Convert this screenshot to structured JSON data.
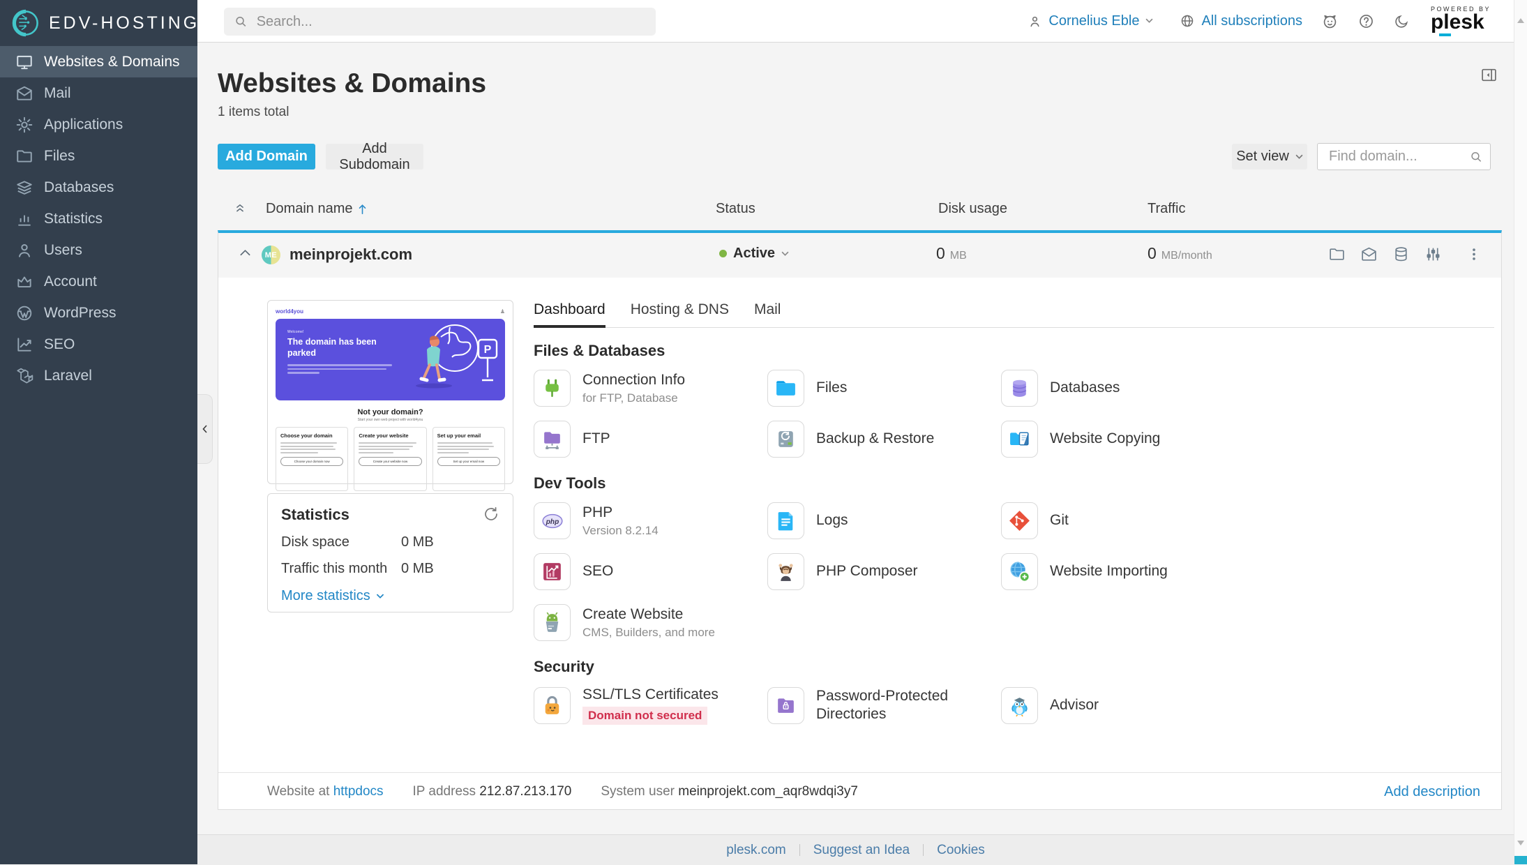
{
  "colors": {
    "accent": "#28aade",
    "link": "#2287c6",
    "sidebar_bg": "#333f4d",
    "sidebar_active": "#4d5c6b",
    "status_green": "#7fb543",
    "danger": "#d02e4c",
    "plesk_accent": "#00add8"
  },
  "sidebar": {
    "logo_text": "EDV-HOSTING",
    "items": [
      {
        "label": "Websites & Domains"
      },
      {
        "label": "Mail"
      },
      {
        "label": "Applications"
      },
      {
        "label": "Files"
      },
      {
        "label": "Databases"
      },
      {
        "label": "Statistics"
      },
      {
        "label": "Users"
      },
      {
        "label": "Account"
      },
      {
        "label": "WordPress"
      },
      {
        "label": "SEO"
      },
      {
        "label": "Laravel"
      }
    ]
  },
  "topbar": {
    "search_placeholder": "Search...",
    "user": "Cornelius Eble",
    "subscriptions": "All subscriptions",
    "powered_by": "POWERED BY",
    "plesk": "plesk"
  },
  "page": {
    "title": "Websites & Domains",
    "items_total": "1 items total",
    "add_domain": "Add Domain",
    "add_subdomain": "Add Subdomain",
    "set_view": "Set view",
    "find_placeholder": "Find domain..."
  },
  "table": {
    "domain": "Domain name",
    "status": "Status",
    "disk": "Disk usage",
    "traffic": "Traffic"
  },
  "domain": {
    "name": "meinprojekt.com",
    "avatar": "ME",
    "status": "Active",
    "disk_value": "0",
    "disk_unit": "MB",
    "traffic_value": "0",
    "traffic_unit": "MB/month"
  },
  "preview": {
    "brand": "world4you",
    "welcome": "Welcome!",
    "headline": "The domain has been parked",
    "not_your_domain": "Not your domain?",
    "subline": "Start your own web project with world4you",
    "cards": [
      {
        "title": "Choose your domain",
        "button": "Choose your domain now"
      },
      {
        "title": "Create your website",
        "button": "Create your website now"
      },
      {
        "title": "Set up your email",
        "button": "Set up your email now"
      }
    ]
  },
  "stats": {
    "title": "Statistics",
    "disk_label": "Disk space",
    "disk_value": "0 MB",
    "traffic_label": "Traffic this month",
    "traffic_value": "0 MB",
    "more_label": "More statistics"
  },
  "tabs": {
    "items": [
      {
        "label": "Dashboard"
      },
      {
        "label": "Hosting & DNS"
      },
      {
        "label": "Mail"
      }
    ]
  },
  "sections": [
    {
      "title": "Files & Databases",
      "items": [
        {
          "label": "Connection Info",
          "sub": "for FTP, Database"
        },
        {
          "label": "Files"
        },
        {
          "label": "Databases"
        },
        {
          "label": "FTP"
        },
        {
          "label": "Backup & Restore"
        },
        {
          "label": "Website Copying"
        }
      ]
    },
    {
      "title": "Dev Tools",
      "items": [
        {
          "label": "PHP",
          "sub": "Version 8.2.14"
        },
        {
          "label": "Logs"
        },
        {
          "label": "Git"
        },
        {
          "label": "SEO"
        },
        {
          "label": "PHP Composer"
        },
        {
          "label": "Website Importing"
        },
        {
          "label": "Create Website",
          "sub": "CMS, Builders, and more"
        }
      ]
    },
    {
      "title": "Security",
      "items": [
        {
          "label": "SSL/TLS Certificates",
          "badge": "Domain not secured"
        },
        {
          "label": "Password-Protected Directories"
        },
        {
          "label": "Advisor"
        }
      ]
    }
  ],
  "card_footer": {
    "website_at": "Website at",
    "httpdocs": "httpdocs",
    "ip_label": "IP address",
    "ip": "212.87.213.170",
    "sysuser_label": "System user",
    "sysuser": "meinprojekt.com_aqr8wdqi3y7",
    "add_description": "Add description"
  },
  "footer": {
    "links": [
      "plesk.com",
      "Suggest an Idea",
      "Cookies"
    ]
  }
}
